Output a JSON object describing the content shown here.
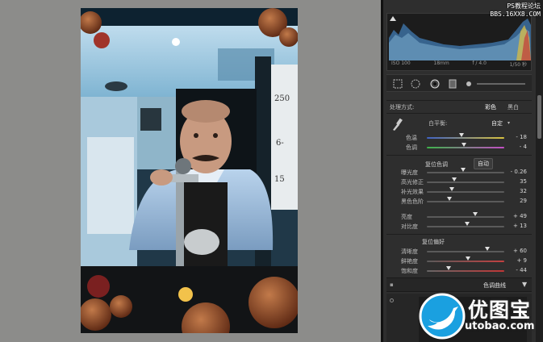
{
  "watermark_top": {
    "line1": "PS教程论坛",
    "line2": "BBS.16XX8.COM"
  },
  "histogram": {
    "iso": "ISO 100",
    "focal": "18mm",
    "aperture": "f / 4.0",
    "shutter": "1/50 秒"
  },
  "treatment": {
    "label": "处理方式:",
    "color": "彩色",
    "bw": "黑白"
  },
  "white_balance": {
    "label": "白平衡:",
    "preset": "自定",
    "temp": {
      "label": "色温",
      "value": "- 18",
      "fraction": 0.45
    },
    "tint": {
      "label": "色调",
      "value": "- 4",
      "fraction": 0.48
    }
  },
  "tone": {
    "header": "复位色调",
    "auto": "自动",
    "sliders": [
      {
        "label": "曝光度",
        "value": "- 0.26",
        "fraction": 0.47
      },
      {
        "label": "高光修正",
        "value": "35",
        "fraction": 0.35
      },
      {
        "label": "补光效果",
        "value": "32",
        "fraction": 0.32
      },
      {
        "label": "黑色色阶",
        "value": "29",
        "fraction": 0.29
      }
    ],
    "sliders2": [
      {
        "label": "亮度",
        "value": "+ 49",
        "fraction": 0.62
      },
      {
        "label": "对比度",
        "value": "+ 13",
        "fraction": 0.52
      }
    ]
  },
  "presence": {
    "header": "复位偏好",
    "sliders": [
      {
        "label": "清晰度",
        "value": "+ 60",
        "fraction": 0.78
      },
      {
        "label": "鲜艳度",
        "value": "+ 9",
        "fraction": 0.53
      },
      {
        "label": "饱和度",
        "value": "- 44",
        "fraction": 0.28
      }
    ]
  },
  "tone_curve": {
    "label": "色调曲线"
  },
  "logo": {
    "title": "优图宝",
    "url": "utobao.com"
  },
  "colors": {
    "panel": "#2e2e2e",
    "accent_blue": "#1aa0e0"
  }
}
